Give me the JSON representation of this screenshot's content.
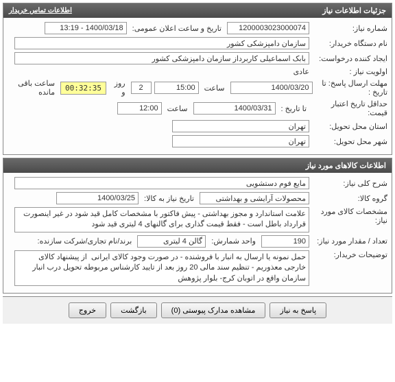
{
  "section1": {
    "title": "جزئیات اطلاعات نیاز",
    "buyer_contact_link": "اطلاعات تماس خریدار",
    "need_number_label": "شماره نیاز:",
    "need_number": "1200003023000074",
    "announce_label": "تاریخ و ساعت اعلان عمومی:",
    "announce_value": "1400/03/18 - 13:19",
    "buyer_org_label": "نام دستگاه خریدار:",
    "buyer_org": "سازمان دامپزشکی کشور",
    "requester_label": "ایجاد کننده درخواست:",
    "requester": "بابک اسماعیلی کاربرداز سازمان دامپزشکی کشور",
    "priority_label": "اولویت نیاز :",
    "priority": "عادی",
    "deadline_label": "مهلت ارسال پاسخ:  تا تاریخ :",
    "deadline_date": "1400/03/20",
    "time_label": "ساعت",
    "deadline_time": "15:00",
    "days_remain": "2",
    "days_label": "روز و",
    "countdown": "00:32:35",
    "remain_label": "ساعت باقی مانده",
    "validity_label": "حداقل تاریخ اعتبار قیمت:",
    "validity_until_label": "تا تاریخ :",
    "validity_date": "1400/03/31",
    "validity_time": "12:00",
    "delivery_province_label": "استان محل تحویل:",
    "delivery_province": "تهران",
    "delivery_city_label": "شهر محل تحویل:",
    "delivery_city": "تهران"
  },
  "section2": {
    "title": "اطلاعات کالاهای مورد نیاز",
    "desc_label": "شرح کلی نیاز:",
    "desc": "مایع فوم دستشویی",
    "group_label": "گروه کالا:",
    "group": "محصولات آرایشی و بهداشتی",
    "need_date_label": "تاریخ نیاز به کالا:",
    "need_date": "1400/03/25",
    "spec_label": "مشخصات کالای مورد نیاز:",
    "spec": "علامت استاندارد و مجوز بهداشتی - پیش فاکتور با مشخصات کامل قید شود در غیر اینصورت قرارداد باطل است - فقط قیمت گذاری برای گالنهای 4 لیتری قید شود",
    "qty_label": "تعداد / مقدار مورد نیاز:",
    "qty": "190",
    "unit_label": "واحد شمارش:",
    "unit": "گالن 4 لیتری",
    "brand_label": "برند/نام تجاری/شرکت سازنده:",
    "notes_label": "توضیحات خریدار:",
    "notes": "حمل نمونه یا ارسال به انبار با فروشنده - در صورت وجود کالای ایرانی  از پیشنهاد کالای خارجی معذوریم - تنظیم سند مالی 20 روز بعد از تایید کارشناس مربوطه تحویل درب انبار سازمان واقع در اتوبان کرج- بلوار پژوهش"
  },
  "buttons": {
    "reply": "پاسخ به نیاز",
    "attachments": "مشاهده مدارک پیوستی (0)",
    "back": "بازگشت",
    "exit": "خروج"
  }
}
